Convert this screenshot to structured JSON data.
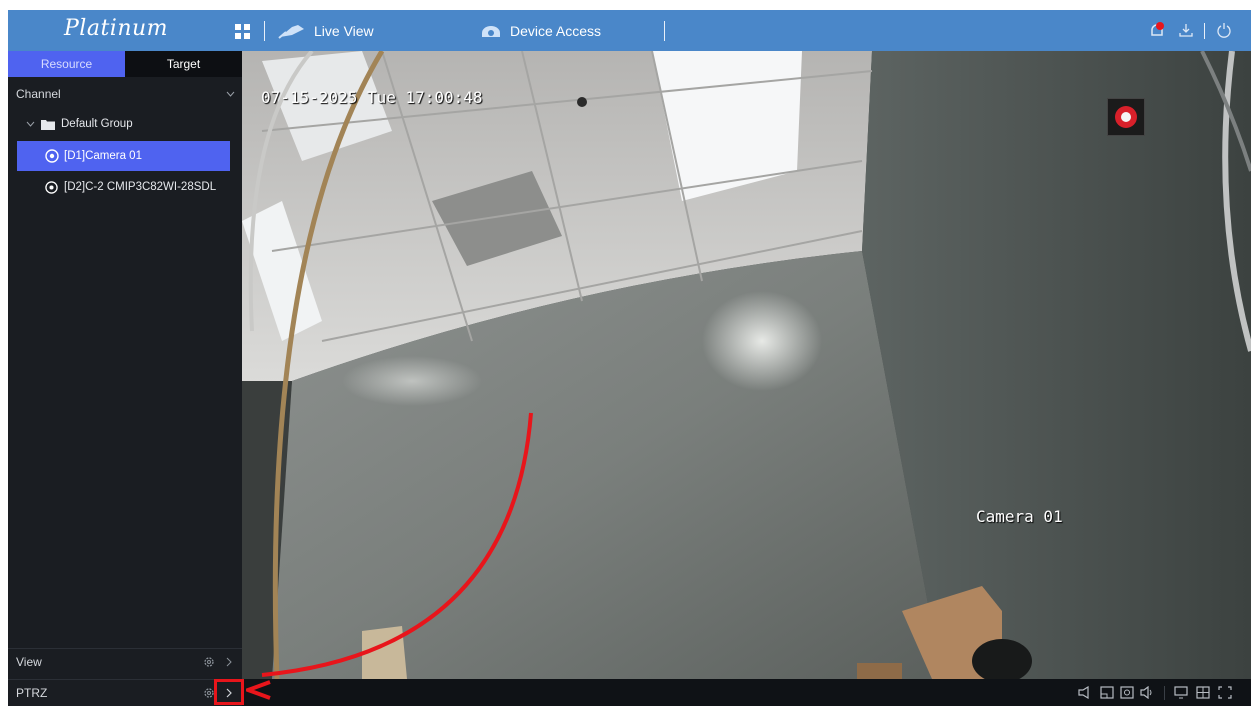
{
  "app": {
    "logo": "Platinum",
    "nav": {
      "live_view": "Live View",
      "device_access": "Device Access"
    }
  },
  "sidebar": {
    "tabs": {
      "resource": "Resource",
      "target": "Target"
    },
    "channel_label": "Channel",
    "group": "Default Group",
    "cameras": [
      "[D1]Camera 01",
      "[D2]C-2 CMIP3C82WI-28SDL"
    ],
    "view_label": "View",
    "ptrz_label": "PTRZ"
  },
  "video": {
    "timestamp": "07-15-2025 Tue 17:00:48",
    "camera_name": "Camera 01"
  },
  "colors": {
    "topbar": "#4a87c9",
    "accent": "#4f63f0",
    "annotation": "#e8151b"
  }
}
